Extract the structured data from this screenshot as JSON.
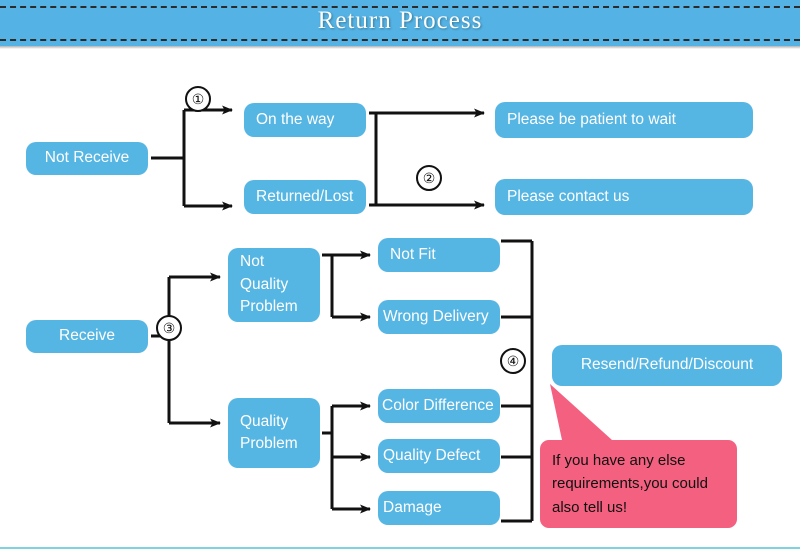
{
  "header": {
    "title": "Return Process"
  },
  "flow": {
    "branch_not_receive": {
      "root_label": "Not Receive",
      "step_marker_1": "①",
      "step_marker_2": "②",
      "states": [
        {
          "label": "On the way"
        },
        {
          "label": "Returned/Lost"
        }
      ],
      "outcomes": [
        {
          "label": "Please be patient to wait"
        },
        {
          "label": "Please contact us"
        }
      ]
    },
    "branch_receive": {
      "root_label": "Receive",
      "step_marker_3": "③",
      "step_marker_4": "④",
      "categories": [
        {
          "label": "Not\nQuality\nProblem"
        },
        {
          "label": "Quality\nProblem"
        }
      ],
      "reasons_not_quality": [
        {
          "label": "Not Fit"
        },
        {
          "label": "Wrong Delivery"
        }
      ],
      "reasons_quality": [
        {
          "label": "Color Difference"
        },
        {
          "label": "Quality Defect"
        },
        {
          "label": "Damage"
        }
      ],
      "resolution": {
        "label": "Resend/Refund/Discount"
      }
    }
  },
  "callout": {
    "text": "If you have any else requirements,you could also tell us!"
  },
  "colors": {
    "header_blue": "#54b3e4",
    "node_blue": "#55b5e3",
    "callout_pink": "#f4607f",
    "line_black": "#111111",
    "footer_rule": "#7fd3e0",
    "text_white": "#ffffff"
  }
}
